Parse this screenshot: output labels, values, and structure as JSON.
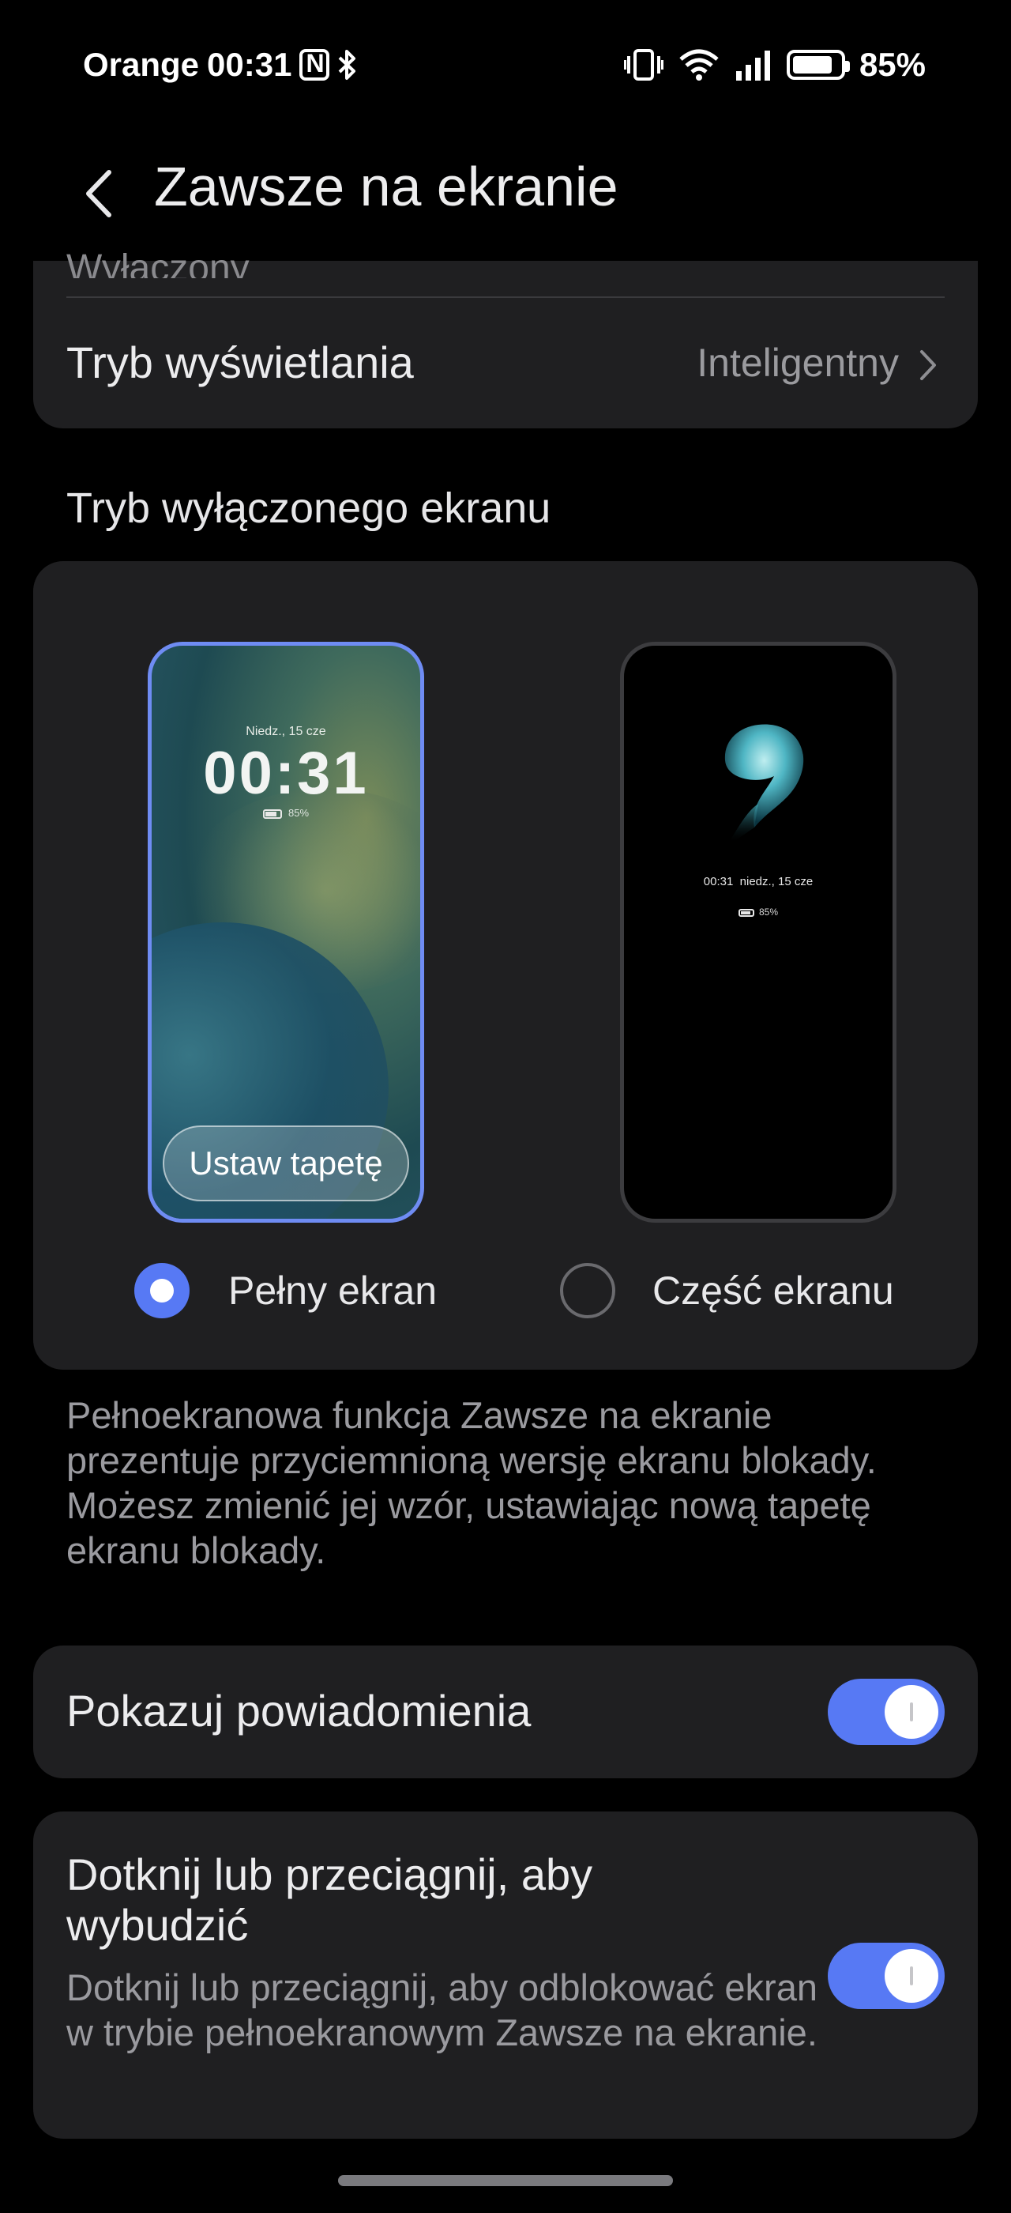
{
  "status_bar": {
    "carrier": "Orange",
    "time": "00:31",
    "battery_percent": "85%",
    "battery_level": 0.85,
    "icons": [
      "nfc-icon",
      "bluetooth-icon",
      "vibrate-icon",
      "wifi-icon",
      "signal-icon",
      "battery-icon"
    ]
  },
  "header": {
    "title": "Zawsze na ekranie",
    "back_icon": "chevron-left-icon"
  },
  "display_card": {
    "clipped_text": "Wyłączony",
    "display_mode_label": "Tryb wyświetlania",
    "display_mode_value": "Inteligentny"
  },
  "screen_off_mode": {
    "section_label": "Tryb wyłączonego ekranu",
    "full_preview": {
      "date": "Niedz., 15 cze",
      "clock": "00:31",
      "battery": "85%",
      "set_wallpaper_label": "Ustaw tapetę"
    },
    "partial_preview": {
      "time": "00:31",
      "date": "niedz., 15 cze",
      "battery": "85%"
    },
    "options": [
      {
        "label": "Pełny ekran",
        "selected": true
      },
      {
        "label": "Część ekranu",
        "selected": false
      }
    ],
    "description": "Pełnoekranowa funkcja Zawsze na ekranie prezentuje przyciemnioną wersję ekranu blokady. Możesz zmienić jej wzór, ustawiając nową tapetę ekranu blokady."
  },
  "show_notifications": {
    "label": "Pokazuj powiadomienia",
    "enabled": true
  },
  "tap_to_wake": {
    "title": "Dotknij lub przeciągnij, aby wybudzić",
    "subtitle": "Dotknij lub przeciągnij, aby odblokować ekran w trybie pełnoekranowym Zawsze na ekranie.",
    "enabled": true
  },
  "colors": {
    "accent": "#5779f4",
    "card_bg": "#1f1f21",
    "background": "#000000"
  }
}
